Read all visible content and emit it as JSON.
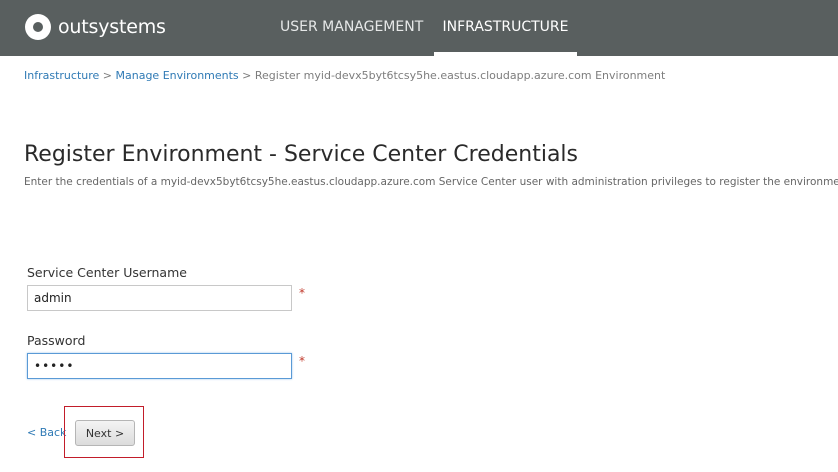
{
  "header": {
    "logo_text": "outsystems",
    "tabs": [
      {
        "label": "USER MANAGEMENT",
        "active": false
      },
      {
        "label": "INFRASTRUCTURE",
        "active": true
      }
    ],
    "bg_color": "#595f5f"
  },
  "breadcrumb": {
    "items": [
      "Infrastructure",
      "Manage Environments"
    ],
    "separator": ">",
    "current": "Register myid-devx5byt6tcsy5he.eastus.cloudapp.azure.com Environment"
  },
  "page": {
    "title": "Register Environment - Service Center Credentials",
    "subtitle": "Enter the credentials of a myid-devx5byt6tcsy5he.eastus.cloudapp.azure.com Service Center user with administration privileges to register the environment"
  },
  "form": {
    "username": {
      "label": "Service Center Username",
      "value": "admin",
      "required_mark": "*"
    },
    "password": {
      "label": "Password",
      "value": "•••••",
      "required_mark": "*"
    }
  },
  "actions": {
    "back_label": "< Back",
    "next_label": "Next >"
  },
  "colors": {
    "link": "#2f7ab5",
    "required": "#c0392b",
    "highlight": "#c21d2a"
  }
}
